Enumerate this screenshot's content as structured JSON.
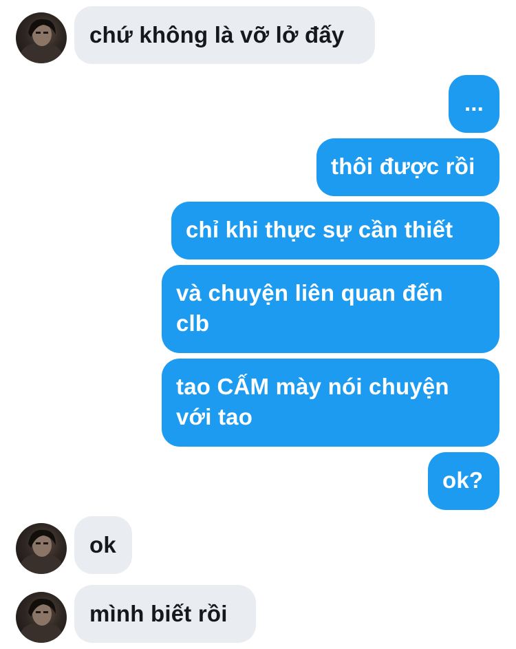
{
  "messages": [
    {
      "sender": "other",
      "text": "chứ không là vỡ lở đấy"
    },
    {
      "sender": "me",
      "text": "..."
    },
    {
      "sender": "me",
      "text": "thôi được rồi"
    },
    {
      "sender": "me",
      "text": "chỉ khi thực sự cần thiết"
    },
    {
      "sender": "me",
      "lines": [
        "và chuyện liên quan đến",
        "clb"
      ]
    },
    {
      "sender": "me",
      "lines": [
        "tao CẤM mày nói chuyện",
        "với tao"
      ]
    },
    {
      "sender": "me",
      "text": "ok?"
    },
    {
      "sender": "other",
      "text": "ok"
    },
    {
      "sender": "other",
      "text": "mình biết rồi"
    }
  ],
  "colors": {
    "outgoing_bubble": "#1d9bf0",
    "incoming_bubble": "#e9ecf1",
    "outgoing_text": "#ffffff",
    "incoming_text": "#15181c"
  },
  "icons": {
    "avatar": "user-avatar-photo"
  }
}
